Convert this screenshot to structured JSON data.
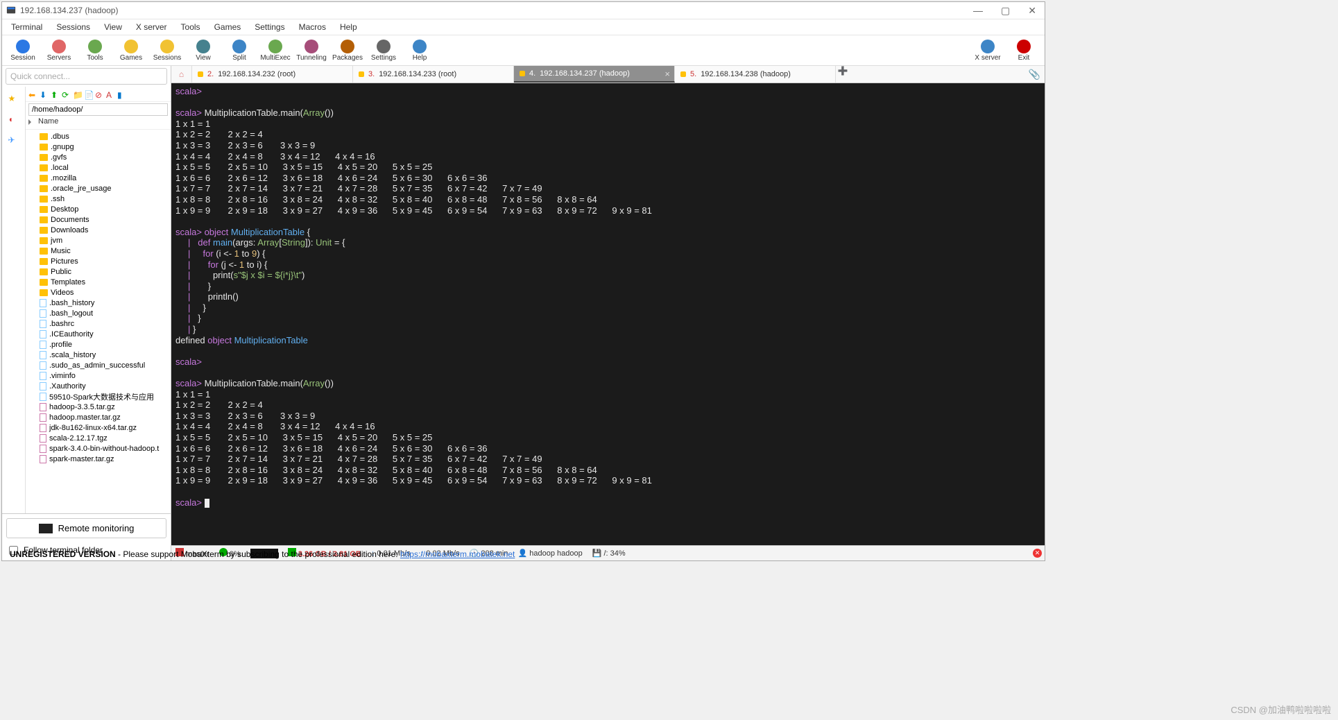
{
  "window": {
    "title": "192.168.134.237 (hadoop)",
    "controls": {
      "minimize": "—",
      "maximize": "▢",
      "close": "✕"
    }
  },
  "menu": [
    "Terminal",
    "Sessions",
    "View",
    "X server",
    "Tools",
    "Games",
    "Settings",
    "Macros",
    "Help"
  ],
  "toolbar_left": [
    {
      "label": "Session",
      "color": "#2b78e4"
    },
    {
      "label": "Servers",
      "color": "#e06666"
    },
    {
      "label": "Tools",
      "color": "#6aa84f"
    },
    {
      "label": "Games",
      "color": "#f1c232"
    },
    {
      "label": "Sessions",
      "color": "#f1c232"
    },
    {
      "label": "View",
      "color": "#45818e"
    },
    {
      "label": "Split",
      "color": "#3d85c6"
    },
    {
      "label": "MultiExec",
      "color": "#6aa84f"
    },
    {
      "label": "Tunneling",
      "color": "#a64d79"
    },
    {
      "label": "Packages",
      "color": "#b45f06"
    },
    {
      "label": "Settings",
      "color": "#666666"
    },
    {
      "label": "Help",
      "color": "#3d85c6"
    }
  ],
  "toolbar_right": [
    {
      "label": "X server",
      "color": "#3d85c6"
    },
    {
      "label": "Exit",
      "color": "#cc0000"
    }
  ],
  "quick_connect": "Quick connect...",
  "sidebar": {
    "path": "/home/hadoop/",
    "header_name": "Name",
    "items": [
      {
        "name": ".dbus",
        "type": "folder"
      },
      {
        "name": ".gnupg",
        "type": "folder"
      },
      {
        "name": ".gvfs",
        "type": "folder"
      },
      {
        "name": ".local",
        "type": "folder"
      },
      {
        "name": ".mozilla",
        "type": "folder"
      },
      {
        "name": ".oracle_jre_usage",
        "type": "folder"
      },
      {
        "name": ".ssh",
        "type": "folder"
      },
      {
        "name": "Desktop",
        "type": "folder"
      },
      {
        "name": "Documents",
        "type": "folder"
      },
      {
        "name": "Downloads",
        "type": "folder"
      },
      {
        "name": "jvm",
        "type": "folder"
      },
      {
        "name": "Music",
        "type": "folder"
      },
      {
        "name": "Pictures",
        "type": "folder"
      },
      {
        "name": "Public",
        "type": "folder"
      },
      {
        "name": "Templates",
        "type": "folder"
      },
      {
        "name": "Videos",
        "type": "folder"
      },
      {
        "name": ".bash_history",
        "type": "file"
      },
      {
        "name": ".bash_logout",
        "type": "file"
      },
      {
        "name": ".bashrc",
        "type": "file"
      },
      {
        "name": ".ICEauthority",
        "type": "file"
      },
      {
        "name": ".profile",
        "type": "file"
      },
      {
        "name": ".scala_history",
        "type": "file"
      },
      {
        "name": ".sudo_as_admin_successful",
        "type": "file"
      },
      {
        "name": ".viminfo",
        "type": "file"
      },
      {
        "name": ".Xauthority",
        "type": "file"
      },
      {
        "name": "59510-Spark大数据技术与应用",
        "type": "file"
      },
      {
        "name": "hadoop-3.3.5.tar.gz",
        "type": "archive"
      },
      {
        "name": "hadoop.master.tar.gz",
        "type": "archive"
      },
      {
        "name": "jdk-8u162-linux-x64.tar.gz",
        "type": "archive"
      },
      {
        "name": "scala-2.12.17.tgz",
        "type": "archive"
      },
      {
        "name": "spark-3.4.0-bin-without-hadoop.t",
        "type": "archive"
      },
      {
        "name": "spark-master.tar.gz",
        "type": "archive"
      }
    ],
    "remote_monitoring": "Remote monitoring",
    "follow_terminal": "Follow terminal folder"
  },
  "tabs": [
    {
      "num": "2.",
      "label": "192.168.134.232 (root)",
      "active": false
    },
    {
      "num": "3.",
      "label": "192.168.134.233 (root)",
      "active": false
    },
    {
      "num": "4.",
      "label": "192.168.134.237 (hadoop)",
      "active": true
    },
    {
      "num": "5.",
      "label": "192.168.134.238 (hadoop)",
      "active": false
    }
  ],
  "terminal": {
    "lines": [
      {
        "segs": [
          {
            "t": "scala>",
            "c": "prompt"
          }
        ]
      },
      {
        "segs": []
      },
      {
        "segs": [
          {
            "t": "scala>",
            "c": "prompt"
          },
          {
            "t": " MultiplicationTable.main(",
            "c": "plain"
          },
          {
            "t": "Array",
            "c": "ty"
          },
          {
            "t": "())",
            "c": "plain"
          }
        ]
      },
      {
        "segs": [
          {
            "t": "1 x 1 = 1",
            "c": "plain"
          }
        ]
      },
      {
        "segs": [
          {
            "t": "1 x 2 = 2       2 x 2 = 4",
            "c": "plain"
          }
        ]
      },
      {
        "segs": [
          {
            "t": "1 x 3 = 3       2 x 3 = 6       3 x 3 = 9",
            "c": "plain"
          }
        ]
      },
      {
        "segs": [
          {
            "t": "1 x 4 = 4       2 x 4 = 8       3 x 4 = 12      4 x 4 = 16",
            "c": "plain"
          }
        ]
      },
      {
        "segs": [
          {
            "t": "1 x 5 = 5       2 x 5 = 10      3 x 5 = 15      4 x 5 = 20      5 x 5 = 25",
            "c": "plain"
          }
        ]
      },
      {
        "segs": [
          {
            "t": "1 x 6 = 6       2 x 6 = 12      3 x 6 = 18      4 x 6 = 24      5 x 6 = 30      6 x 6 = 36",
            "c": "plain"
          }
        ]
      },
      {
        "segs": [
          {
            "t": "1 x 7 = 7       2 x 7 = 14      3 x 7 = 21      4 x 7 = 28      5 x 7 = 35      6 x 7 = 42      7 x 7 = 49",
            "c": "plain"
          }
        ]
      },
      {
        "segs": [
          {
            "t": "1 x 8 = 8       2 x 8 = 16      3 x 8 = 24      4 x 8 = 32      5 x 8 = 40      6 x 8 = 48      7 x 8 = 56      8 x 8 = 64",
            "c": "plain"
          }
        ]
      },
      {
        "segs": [
          {
            "t": "1 x 9 = 9       2 x 9 = 18      3 x 9 = 27      4 x 9 = 36      5 x 9 = 45      6 x 9 = 54      7 x 9 = 63      8 x 9 = 72      9 x 9 = 81",
            "c": "plain"
          }
        ]
      },
      {
        "segs": []
      },
      {
        "segs": [
          {
            "t": "scala>",
            "c": "prompt"
          },
          {
            "t": " ",
            "c": "plain"
          },
          {
            "t": "object",
            "c": "kw"
          },
          {
            "t": " ",
            "c": "plain"
          },
          {
            "t": "MultiplicationTable",
            "c": "fn"
          },
          {
            "t": " {",
            "c": "plain"
          }
        ]
      },
      {
        "segs": [
          {
            "t": "     |",
            "c": "pipe"
          },
          {
            "t": "   ",
            "c": "plain"
          },
          {
            "t": "def",
            "c": "kw"
          },
          {
            "t": " ",
            "c": "plain"
          },
          {
            "t": "main",
            "c": "fn"
          },
          {
            "t": "(args: ",
            "c": "plain"
          },
          {
            "t": "Array",
            "c": "ty"
          },
          {
            "t": "[",
            "c": "plain"
          },
          {
            "t": "String",
            "c": "ty"
          },
          {
            "t": "]): ",
            "c": "plain"
          },
          {
            "t": "Unit",
            "c": "ty"
          },
          {
            "t": " = {",
            "c": "plain"
          }
        ]
      },
      {
        "segs": [
          {
            "t": "     |",
            "c": "pipe"
          },
          {
            "t": "     ",
            "c": "plain"
          },
          {
            "t": "for",
            "c": "kw"
          },
          {
            "t": " (i <- ",
            "c": "plain"
          },
          {
            "t": "1",
            "c": "lit"
          },
          {
            "t": " to ",
            "c": "plain"
          },
          {
            "t": "9",
            "c": "lit"
          },
          {
            "t": ") {",
            "c": "plain"
          }
        ]
      },
      {
        "segs": [
          {
            "t": "     |",
            "c": "pipe"
          },
          {
            "t": "       ",
            "c": "plain"
          },
          {
            "t": "for",
            "c": "kw"
          },
          {
            "t": " (j <- ",
            "c": "plain"
          },
          {
            "t": "1",
            "c": "lit"
          },
          {
            "t": " to i) {",
            "c": "plain"
          }
        ]
      },
      {
        "segs": [
          {
            "t": "     |",
            "c": "pipe"
          },
          {
            "t": "         print(",
            "c": "plain"
          },
          {
            "t": "s\"$j x $i = ${i*j}\\t\"",
            "c": "str"
          },
          {
            "t": ")",
            "c": "plain"
          }
        ]
      },
      {
        "segs": [
          {
            "t": "     |",
            "c": "pipe"
          },
          {
            "t": "       }",
            "c": "plain"
          }
        ]
      },
      {
        "segs": [
          {
            "t": "     |",
            "c": "pipe"
          },
          {
            "t": "       println()",
            "c": "plain"
          }
        ]
      },
      {
        "segs": [
          {
            "t": "     |",
            "c": "pipe"
          },
          {
            "t": "     }",
            "c": "plain"
          }
        ]
      },
      {
        "segs": [
          {
            "t": "     |",
            "c": "pipe"
          },
          {
            "t": "   }",
            "c": "plain"
          }
        ]
      },
      {
        "segs": [
          {
            "t": "     |",
            "c": "pipe"
          },
          {
            "t": " }",
            "c": "plain"
          }
        ]
      },
      {
        "segs": [
          {
            "t": "defined ",
            "c": "plain"
          },
          {
            "t": "object",
            "c": "kw"
          },
          {
            "t": " ",
            "c": "plain"
          },
          {
            "t": "MultiplicationTable",
            "c": "fn"
          }
        ]
      },
      {
        "segs": []
      },
      {
        "segs": [
          {
            "t": "scala>",
            "c": "prompt"
          }
        ]
      },
      {
        "segs": []
      },
      {
        "segs": [
          {
            "t": "scala>",
            "c": "prompt"
          },
          {
            "t": " MultiplicationTable.main(",
            "c": "plain"
          },
          {
            "t": "Array",
            "c": "ty"
          },
          {
            "t": "())",
            "c": "plain"
          }
        ]
      },
      {
        "segs": [
          {
            "t": "1 x 1 = 1",
            "c": "plain"
          }
        ]
      },
      {
        "segs": [
          {
            "t": "1 x 2 = 2       2 x 2 = 4",
            "c": "plain"
          }
        ]
      },
      {
        "segs": [
          {
            "t": "1 x 3 = 3       2 x 3 = 6       3 x 3 = 9",
            "c": "plain"
          }
        ]
      },
      {
        "segs": [
          {
            "t": "1 x 4 = 4       2 x 4 = 8       3 x 4 = 12      4 x 4 = 16",
            "c": "plain"
          }
        ]
      },
      {
        "segs": [
          {
            "t": "1 x 5 = 5       2 x 5 = 10      3 x 5 = 15      4 x 5 = 20      5 x 5 = 25",
            "c": "plain"
          }
        ]
      },
      {
        "segs": [
          {
            "t": "1 x 6 = 6       2 x 6 = 12      3 x 6 = 18      4 x 6 = 24      5 x 6 = 30      6 x 6 = 36",
            "c": "plain"
          }
        ]
      },
      {
        "segs": [
          {
            "t": "1 x 7 = 7       2 x 7 = 14      3 x 7 = 21      4 x 7 = 28      5 x 7 = 35      6 x 7 = 42      7 x 7 = 49",
            "c": "plain"
          }
        ]
      },
      {
        "segs": [
          {
            "t": "1 x 8 = 8       2 x 8 = 16      3 x 8 = 24      4 x 8 = 32      5 x 8 = 40      6 x 8 = 48      7 x 8 = 56      8 x 8 = 64",
            "c": "plain"
          }
        ]
      },
      {
        "segs": [
          {
            "t": "1 x 9 = 9       2 x 9 = 18      3 x 9 = 27      4 x 9 = 36      5 x 9 = 45      6 x 9 = 54      7 x 9 = 63      8 x 9 = 72      9 x 9 = 81",
            "c": "plain"
          }
        ]
      },
      {
        "segs": []
      },
      {
        "segs": [
          {
            "t": "scala>",
            "c": "prompt"
          },
          {
            "t": " ",
            "c": "plain"
          },
          {
            "cursor": true
          }
        ]
      }
    ]
  },
  "status": {
    "host": "master",
    "cpu": "0%",
    "mem": "3.26 GB / 3.81 GB",
    "down": "0.01 Mb/s",
    "up": "0.02 Mb/s",
    "uptime": "208 min",
    "user": "hadoop  hadoop",
    "disk": "/: 34%"
  },
  "footer": {
    "prefix": "UNREGISTERED VERSION",
    "text": "  -  Please support MobaXterm by subscribing to the professional edition here:  ",
    "url": "https://mobaxterm.mobatek.net"
  },
  "watermark": "CSDN @加油鸭啦啦啦啦"
}
